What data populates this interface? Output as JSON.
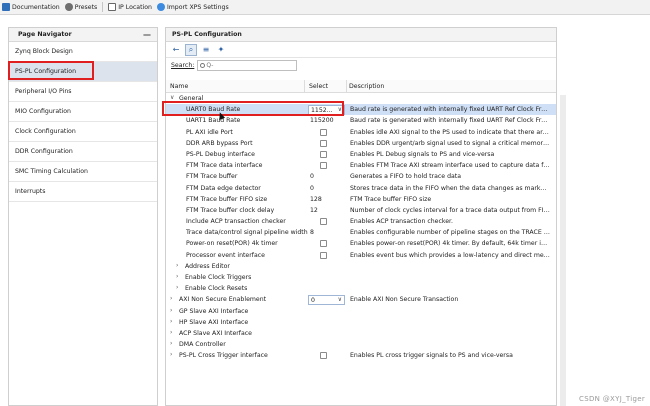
{
  "toolbar": {
    "documentation": "Documentation",
    "presets": "Presets",
    "ip_location": "IP Location",
    "import_xps": "Import XPS Settings"
  },
  "navigator": {
    "title": "Page Navigator",
    "menu": "—",
    "items": [
      "Zynq Block Design",
      "PS-PL Configuration",
      "Peripheral I/O Pins",
      "MIO Configuration",
      "Clock Configuration",
      "DDR Configuration",
      "SMC Timing Calculation",
      "Interrupts"
    ],
    "selected": 1
  },
  "main": {
    "title": "PS-PL Configuration",
    "search_label": "Search:",
    "search_placeholder": "Q-",
    "columns": {
      "name": "Name",
      "select": "Select",
      "description": "Description"
    },
    "tree": [
      {
        "label": "General",
        "indent": 1,
        "arrow": "v",
        "type": "group"
      },
      {
        "label": "UART0 Baud Rate",
        "indent": 3,
        "type": "dropdown",
        "value": "1152...",
        "desc": "Baud rate is generated with internally fixed UART Ref Clock Freq=10...",
        "hl": true
      },
      {
        "label": "UART1 Baud Rate",
        "indent": 3,
        "type": "text",
        "value": "115200",
        "desc": "Baud rate is generated with internally fixed UART Ref Clock Freq=10..."
      },
      {
        "label": "PL AXI idle Port",
        "indent": 3,
        "type": "check",
        "desc": "Enables idle AXI signal to the PS used to indicate that there are no o..."
      },
      {
        "label": "DDR ARB bypass Port",
        "indent": 3,
        "type": "check",
        "desc": "Enables DDR urgent/arb signal used to signal a critical memory star..."
      },
      {
        "label": "PS-PL Debug interface",
        "indent": 3,
        "type": "check",
        "desc": "Enables PL Debug signals to PS and vice-versa"
      },
      {
        "label": "FTM Trace data interface",
        "indent": 3,
        "type": "check",
        "desc": "Enables FTM Trace AXI stream interface used to capture data from P..."
      },
      {
        "label": "FTM Trace buffer",
        "indent": 3,
        "type": "text",
        "value": "0",
        "desc": "Generates a FIFO to hold trace data"
      },
      {
        "label": "FTM Data edge detector",
        "indent": 3,
        "type": "text",
        "value": "0",
        "desc": "Stores trace data in the FIFO when the data changes as marked by e..."
      },
      {
        "label": "FTM Trace buffer FIFO size",
        "indent": 3,
        "type": "text",
        "value": "128",
        "desc": "FTM Trace buffer FIFO size"
      },
      {
        "label": "FTM Trace buffer clock delay",
        "indent": 3,
        "type": "text",
        "value": "12",
        "desc": "Number of clock cycles interval for a trace data output from FIFO bein..."
      },
      {
        "label": "Include ACP transaction checker",
        "indent": 3,
        "type": "check",
        "desc": "Enables ACP transaction checker."
      },
      {
        "label": "Trace data/control signal pipeline width",
        "indent": 3,
        "type": "text",
        "value": "8",
        "desc": "Enables configurable number of pipeline stages on the TRACE DAT..."
      },
      {
        "label": "Power-on reset(POR) 4k timer",
        "indent": 3,
        "type": "check",
        "desc": "Enables power-on reset(POR) 4k timer. By default, 64k timer is used."
      },
      {
        "label": "Processor event interface",
        "indent": 3,
        "type": "check",
        "desc": "Enables event bus which provides a low-latency and direct mechanis..."
      },
      {
        "label": "Address Editor",
        "indent": 2,
        "arrow": ">",
        "type": "group"
      },
      {
        "label": "Enable Clock Triggers",
        "indent": 2,
        "arrow": ">",
        "type": "group"
      },
      {
        "label": "Enable Clock Resets",
        "indent": 2,
        "arrow": ">",
        "type": "group"
      },
      {
        "label": "AXI Non Secure Enablement",
        "indent": 1,
        "arrow": ">",
        "type": "dropdown",
        "value": "0",
        "desc": "Enable AXI Non Secure Transaction"
      },
      {
        "label": "GP Slave AXI Interface",
        "indent": 1,
        "arrow": ">",
        "type": "group"
      },
      {
        "label": "HP Slave AXI Interface",
        "indent": 1,
        "arrow": ">",
        "type": "group"
      },
      {
        "label": "ACP Slave AXI Interface",
        "indent": 1,
        "arrow": ">",
        "type": "group"
      },
      {
        "label": "DMA Controller",
        "indent": 1,
        "arrow": ">",
        "type": "group"
      },
      {
        "label": "PS-PL Cross Trigger interface",
        "indent": 1,
        "arrow": ">",
        "type": "check",
        "desc": "Enables PL cross trigger signals to PS and vice-versa"
      }
    ]
  },
  "watermark": "CSDN @XYJ_Tiger"
}
